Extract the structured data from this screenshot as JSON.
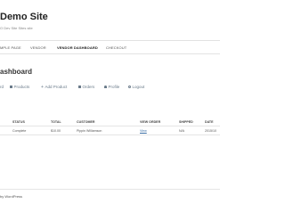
{
  "site": {
    "title": "Demo Site",
    "tagline": "O Dev Site Sites site"
  },
  "nav": {
    "items": [
      {
        "label": "MPLE PAGE",
        "active": false
      },
      {
        "label": "VENDOR",
        "active": false
      },
      {
        "label": "VENDOR DASHBOARD",
        "active": true
      },
      {
        "label": "CHECKOUT",
        "active": false
      }
    ]
  },
  "page": {
    "title": "ashboard"
  },
  "dashboard_nav": {
    "items": [
      {
        "label": "rd",
        "icon": "dashboard-icon"
      },
      {
        "label": "Products",
        "icon": "products-icon"
      },
      {
        "label": "Add Product",
        "icon": "plus-icon"
      },
      {
        "label": "Orders",
        "icon": "orders-icon"
      },
      {
        "label": "Profile",
        "icon": "person-icon"
      },
      {
        "label": "Logout",
        "icon": "power-icon"
      }
    ]
  },
  "orders_table": {
    "headers": [
      "",
      "STATUS",
      "TOTAL",
      "CUSTOMER",
      "VIEW ORDER",
      "SHIPPED",
      "DATE"
    ],
    "rows": [
      {
        "order": "",
        "status": "Complete",
        "total": "$10.00",
        "customer": "Pippin Williamson",
        "view_order": "View",
        "shipped": "N/A",
        "date": "2015/10"
      }
    ]
  },
  "footer": {
    "text": "by WordPress"
  },
  "colors": {
    "link": "#3b6ea5",
    "dashboard_link": "#6a7b8a",
    "border": "#e5e5e5"
  }
}
